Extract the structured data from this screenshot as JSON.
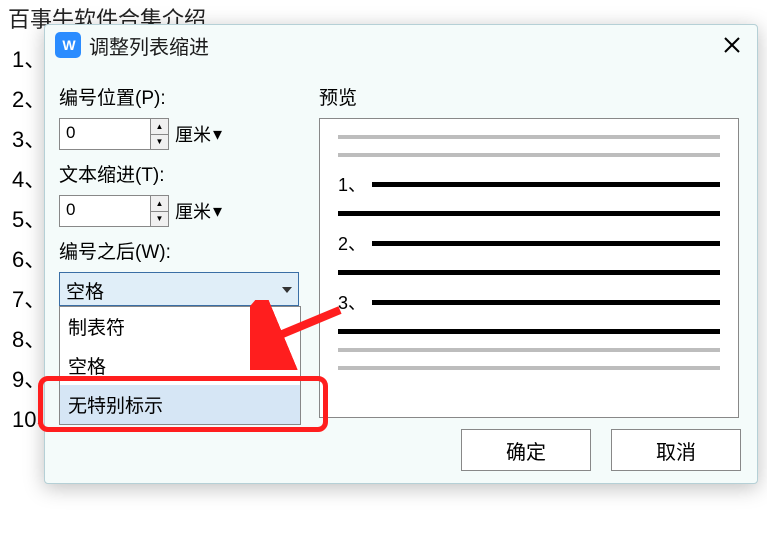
{
  "document": {
    "title": "百事牛软件合集介绍",
    "list_markers": [
      "1、",
      "2、",
      "3、",
      "4、",
      "5、",
      "6、",
      "7、",
      "8、",
      "9、",
      "10、"
    ]
  },
  "dialog": {
    "title": "调整列表缩进",
    "number_position_label": "编号位置(P):",
    "number_position_value": "0",
    "number_position_unit": "厘米",
    "text_indent_label": "文本缩进(T):",
    "text_indent_value": "0",
    "text_indent_unit": "厘米",
    "after_number_label": "编号之后(W):",
    "after_number_value": "空格",
    "after_number_options": [
      "制表符",
      "空格",
      "无特别标示"
    ],
    "preview_label": "预览",
    "preview_numbers": [
      "1、",
      "2、",
      "3、"
    ],
    "ok_label": "确定",
    "cancel_label": "取消"
  },
  "icons": {
    "app_logo_text": "W"
  }
}
